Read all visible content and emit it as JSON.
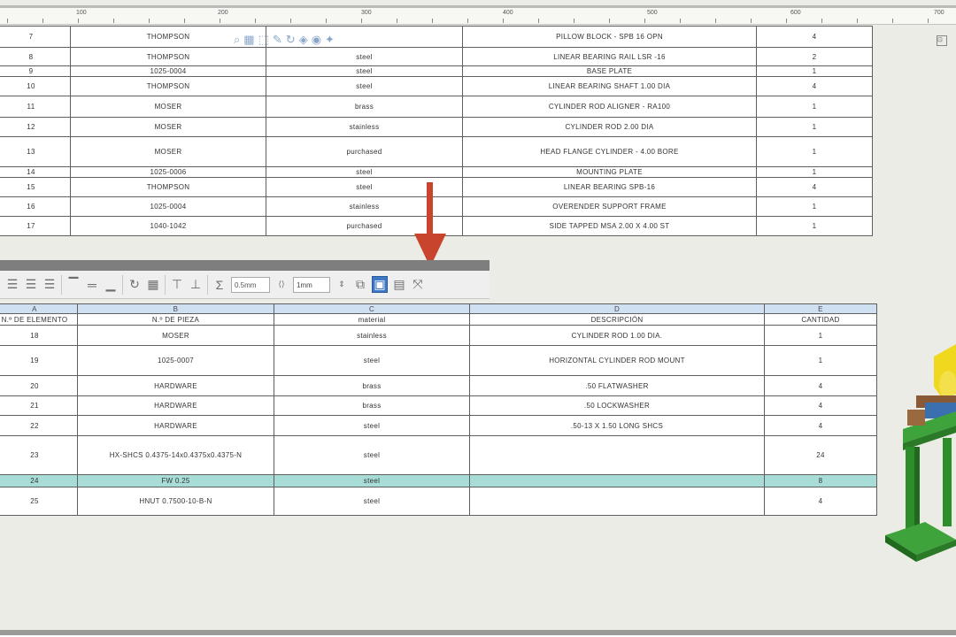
{
  "ruler": {
    "labels": [
      "100",
      "200",
      "300",
      "400",
      "500",
      "600",
      "700"
    ]
  },
  "top_table": {
    "rows": [
      {
        "item": "7",
        "part": "THOMPSON",
        "material": "",
        "description": "PILLOW BLOCK - SPB 16 OPN",
        "qty": "4"
      },
      {
        "item": "8",
        "part": "THOMPSON",
        "material": "steel",
        "description": "LINEAR BEARING RAIL LSR -16",
        "qty": "2"
      },
      {
        "item": "9",
        "part": "1025-0004",
        "material": "steel",
        "description": "BASE PLATE",
        "qty": "1"
      },
      {
        "item": "10",
        "part": "THOMPSON",
        "material": "steel",
        "description": "LINEAR BEARING SHAFT 1.00 DIA",
        "qty": "4"
      },
      {
        "item": "11",
        "part": "MOSER",
        "material": "brass",
        "description": "CYLINDER ROD ALIGNER - RA100",
        "qty": "1"
      },
      {
        "item": "12",
        "part": "MOSER",
        "material": "stainless",
        "description": "CYLINDER ROD 2.00 DIA",
        "qty": "1"
      },
      {
        "item": "13",
        "part": "MOSER",
        "material": "purchased",
        "description": "HEAD FLANGE CYLINDER - 4.00 BORE",
        "qty": "1"
      },
      {
        "item": "14",
        "part": "1025-0006",
        "material": "steel",
        "description": "MOUNTING PLATE",
        "qty": "1"
      },
      {
        "item": "15",
        "part": "THOMPSON",
        "material": "steel",
        "description": "LINEAR BEARING SPB-16",
        "qty": "4"
      },
      {
        "item": "16",
        "part": "1025-0004",
        "material": "stainless",
        "description": "OVERENDER SUPPORT FRAME",
        "qty": "1"
      },
      {
        "item": "17",
        "part": "1040-1042",
        "material": "purchased",
        "description": "SIDE TAPPED MSA 2.00 X 4.00 ST",
        "qty": "1"
      }
    ]
  },
  "format_toolbar": {
    "border_width": "0.5mm",
    "spacing": "1mm"
  },
  "bottom_table": {
    "column_letters": [
      "A",
      "B",
      "C",
      "D",
      "E"
    ],
    "column_names": [
      "N.º DE ELEMENTO",
      "N.º DE PIEZA",
      "material",
      "DESCRIPCIÓN",
      "CANTIDAD"
    ],
    "rows": [
      {
        "item": "18",
        "part": "MOSER",
        "material": "stainless",
        "description": "CYLINDER ROD 1.00 DIA.",
        "qty": "1"
      },
      {
        "item": "19",
        "part": "1025-0007",
        "material": "steel",
        "description": "HORIZONTAL CYLINDER ROD MOUNT",
        "qty": "1"
      },
      {
        "item": "20",
        "part": "HARDWARE",
        "material": "brass",
        "description": ".50 FLATWASHER",
        "qty": "4"
      },
      {
        "item": "21",
        "part": "HARDWARE",
        "material": "brass",
        "description": ".50 LOCKWASHER",
        "qty": "4"
      },
      {
        "item": "22",
        "part": "HARDWARE",
        "material": "steel",
        "description": ".50-13 X 1.50 LONG SHCS",
        "qty": "4"
      },
      {
        "item": "23",
        "part": "HX-SHCS 0.4375-14x0.4375x0.4375-N",
        "material": "steel",
        "description": "",
        "qty": "24"
      },
      {
        "item": "24",
        "part": "FW 0.25",
        "material": "steel",
        "description": "",
        "qty": "8"
      },
      {
        "item": "25",
        "part": "HNUT 0.7500-10-B-N",
        "material": "steel",
        "description": "",
        "qty": "4"
      }
    ]
  },
  "colors": {
    "highlight_row": "#a7ddd6",
    "header_letters": "#cfe0f2",
    "arrow": "#c9442c",
    "active_tool": "#3f78c4"
  }
}
